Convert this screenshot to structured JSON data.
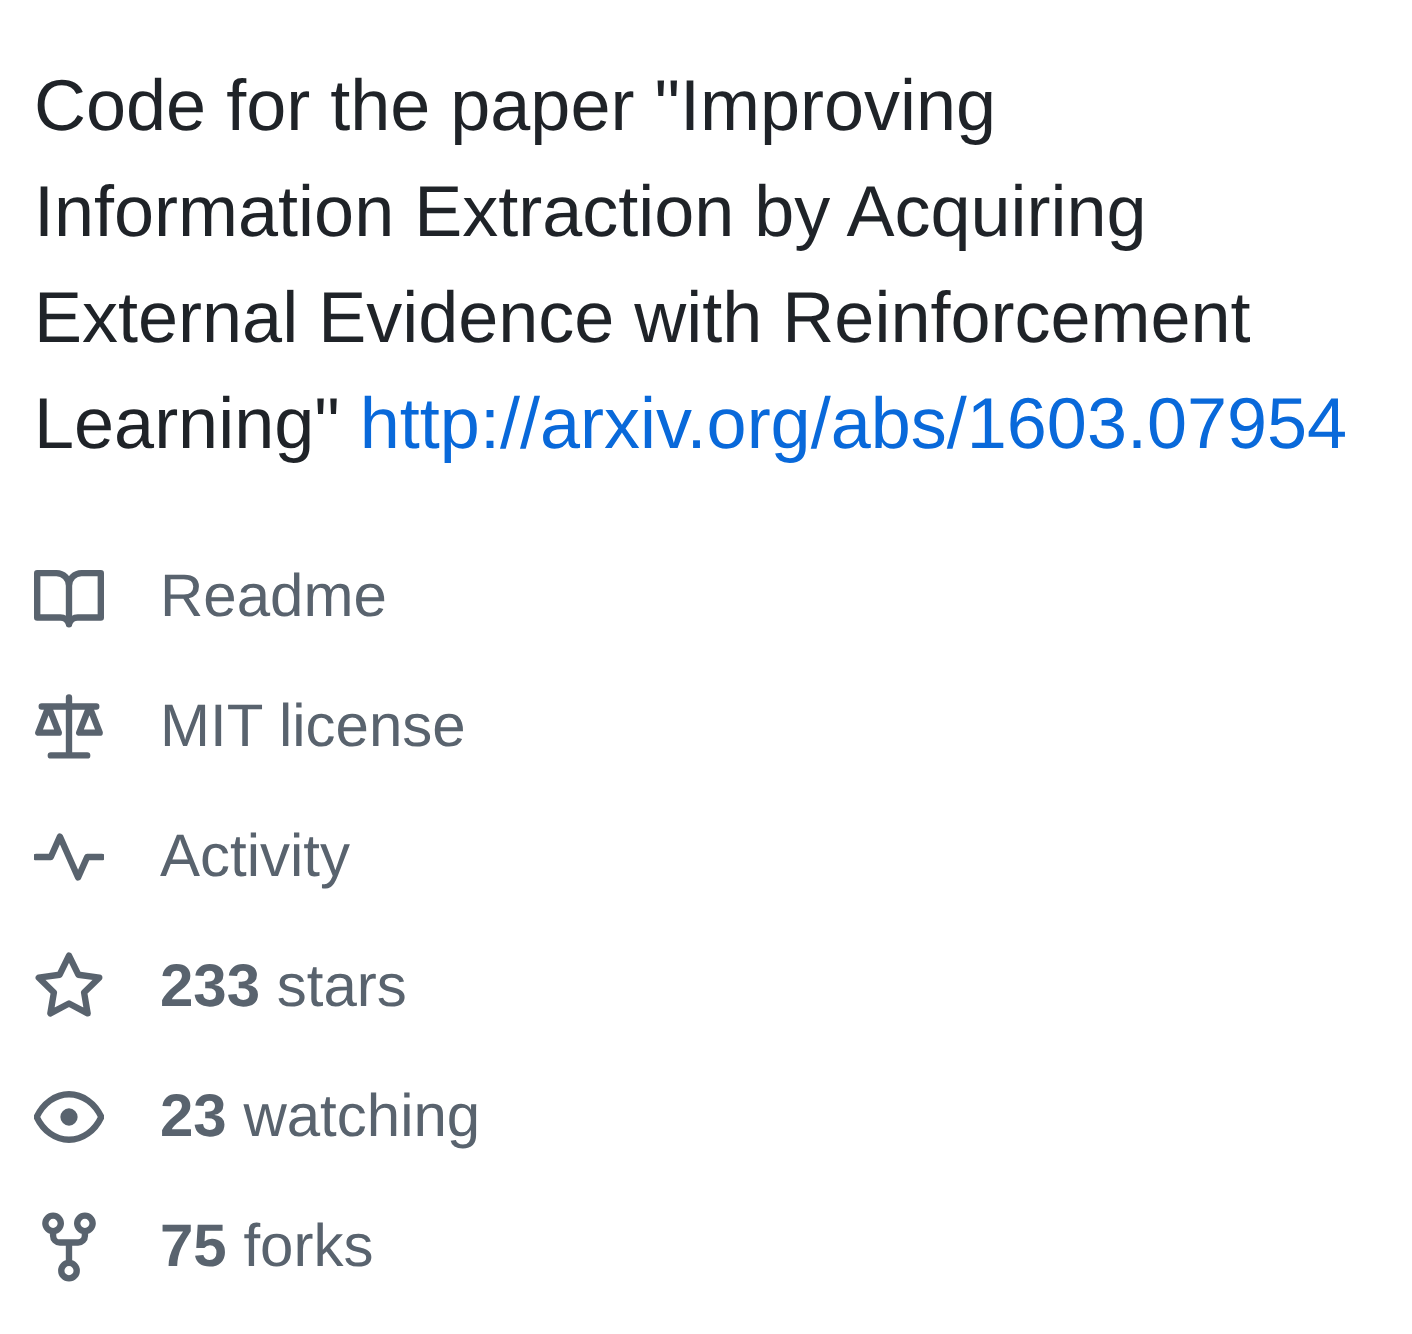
{
  "description": {
    "text": "Code for the paper \"Improving Information Extraction by Acquiring External Evidence with Reinforcement Learning\"",
    "link": "http://arxiv.org/abs/1603.07954"
  },
  "links": [
    {
      "kind": "readme",
      "label": "Readme"
    },
    {
      "kind": "license",
      "label": "MIT license"
    },
    {
      "kind": "activity",
      "label": "Activity"
    },
    {
      "kind": "stars",
      "label": "**233** stars"
    },
    {
      "kind": "watchers",
      "label": "**23** watching"
    },
    {
      "kind": "forks",
      "label": "**75** forks"
    }
  ]
}
